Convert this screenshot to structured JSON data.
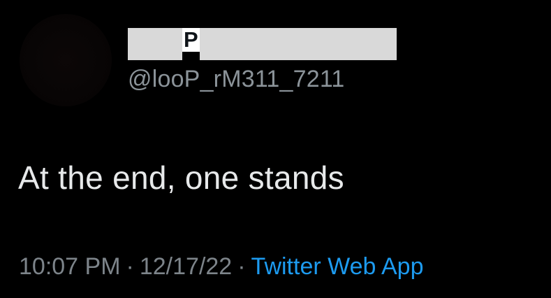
{
  "tweet": {
    "display_name_visible": "P",
    "handle": "@looP_rM311_7211",
    "text": "At the end, one stands",
    "time": "10:07 PM",
    "separator": "·",
    "date": "12/17/22",
    "source_app": "Twitter Web App"
  },
  "colors": {
    "background": "#000000",
    "text": "#e7e9ea",
    "secondary_text": "#7d848a",
    "link": "#1d9bf0",
    "redaction": "#d9d9d9"
  }
}
